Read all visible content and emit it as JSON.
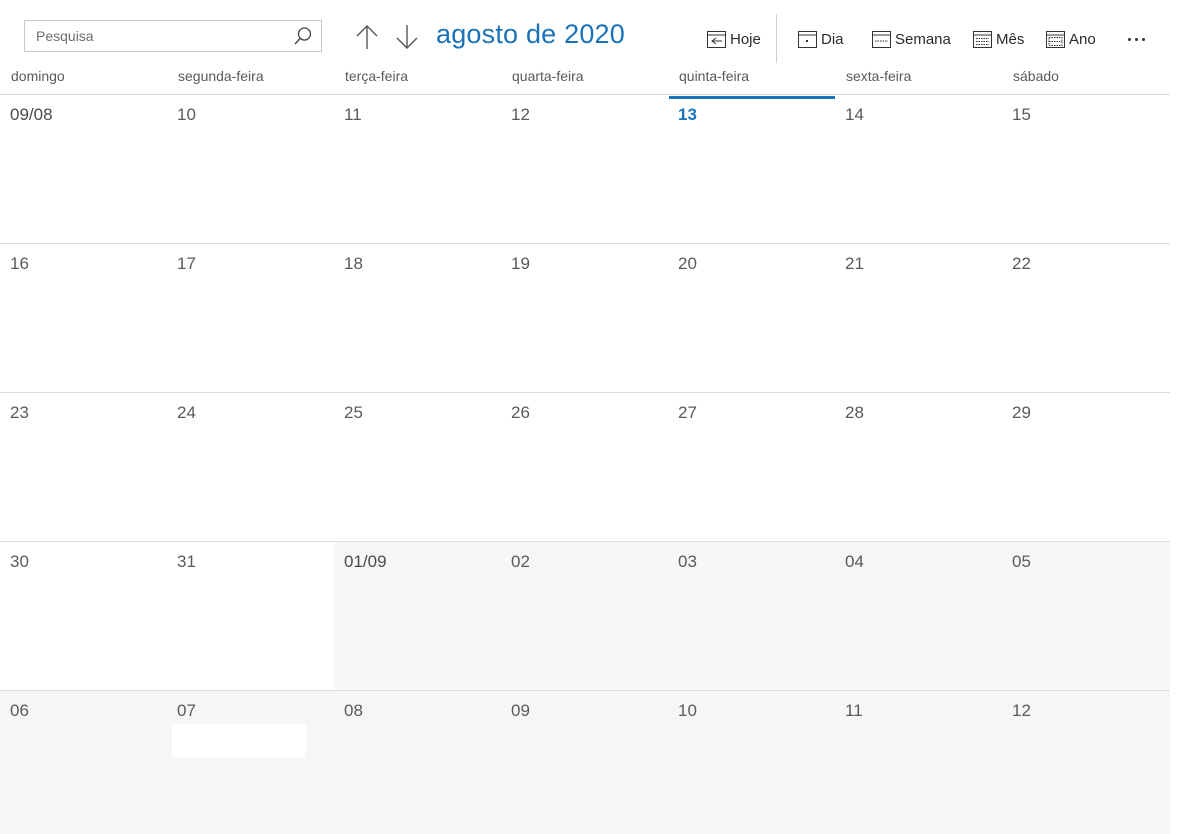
{
  "search": {
    "placeholder": "Pesquisa",
    "value": ""
  },
  "header": {
    "title": "agosto de 2020"
  },
  "toolbar": {
    "today_label": "Hoje",
    "day_label": "Dia",
    "week_label": "Semana",
    "month_label": "Mês",
    "year_label": "Ano"
  },
  "weekdays": [
    "domingo",
    "segunda-feira",
    "terça-feira",
    "quarta-feira",
    "quinta-feira",
    "sexta-feira",
    "sábado"
  ],
  "weeks": [
    [
      "09/08",
      "10",
      "11",
      "12",
      "13",
      "14",
      "15"
    ],
    [
      "16",
      "17",
      "18",
      "19",
      "20",
      "21",
      "22"
    ],
    [
      "23",
      "24",
      "25",
      "26",
      "27",
      "28",
      "29"
    ],
    [
      "30",
      "31",
      "01/09",
      "02",
      "03",
      "04",
      "05"
    ],
    [
      "06",
      "07",
      "08",
      "09",
      "10",
      "11",
      "12"
    ]
  ],
  "today": "13",
  "colors": {
    "accent": "#1a73b9",
    "other_month_bg": "#f6f6f6"
  }
}
